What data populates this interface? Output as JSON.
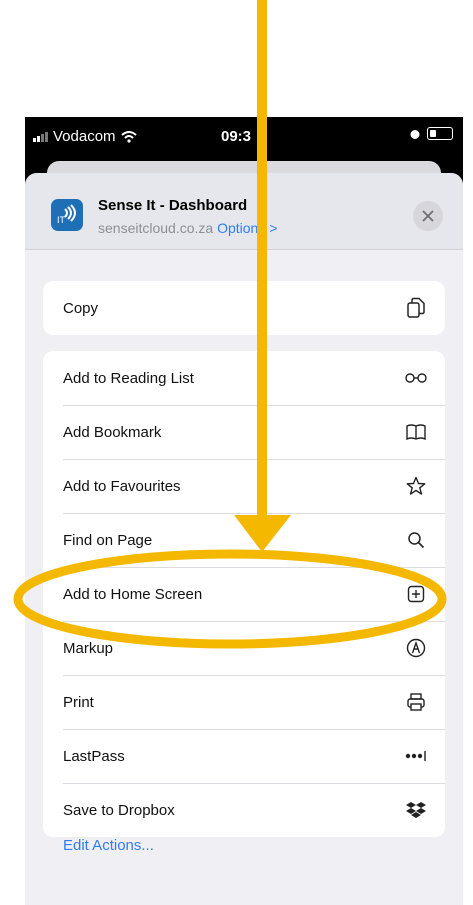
{
  "status": {
    "carrier": "Vodacom",
    "time": "09:3"
  },
  "header": {
    "title": "Sense It - Dashboard",
    "url": "senseitcloud.co.za",
    "options_label": "Options >",
    "close": "×"
  },
  "actions": {
    "copy": "Copy",
    "reading_list": "Add to Reading List",
    "bookmark": "Add Bookmark",
    "favourites": "Add to Favourites",
    "find_on_page": "Find on Page",
    "home_screen": "Add to Home Screen",
    "markup": "Markup",
    "print": "Print",
    "lastpass": "LastPass",
    "dropbox": "Save to Dropbox"
  },
  "footer": {
    "edit_actions": "Edit Actions..."
  },
  "annotation": {
    "color": "#f5b800"
  },
  "colors": {
    "accent": "#2f7df6",
    "sheet": "#efeff4"
  }
}
